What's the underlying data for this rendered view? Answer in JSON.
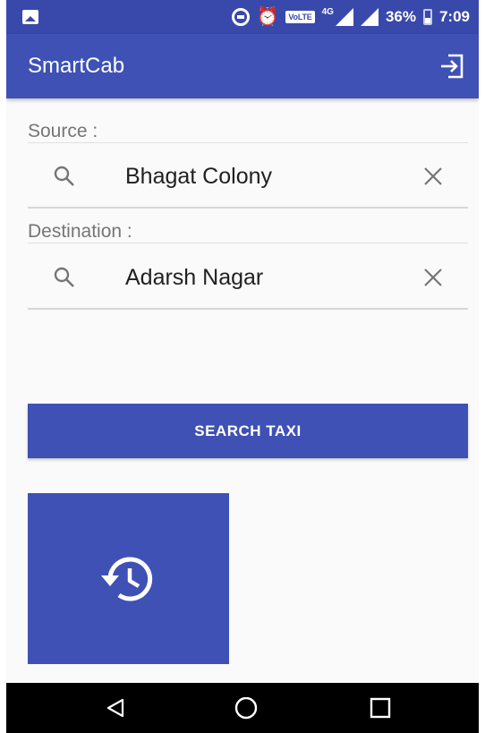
{
  "status_bar": {
    "network_label": "4G",
    "volte_label": "VoLTE",
    "battery": "36%",
    "time": "7:09",
    "icons": [
      "gallery-icon",
      "data-saver-icon",
      "alarm-icon",
      "signal-icon",
      "battery-icon"
    ]
  },
  "app_bar": {
    "title": "SmartCab",
    "action_icon": "logout-icon"
  },
  "form": {
    "source": {
      "label": "Source :",
      "value": "Bhagat Colony"
    },
    "destination": {
      "label": "Destination :",
      "value": "Adarsh Nagar"
    }
  },
  "search_button": {
    "label": "SEARCH TAXI"
  },
  "history_tile": {
    "icon": "history-icon"
  },
  "nav_bar": {
    "icons": [
      "back-icon",
      "home-icon",
      "recents-icon"
    ]
  },
  "colors": {
    "primary": "#3f51b5",
    "primary_dark": "#3949ab",
    "background": "#fafafa"
  }
}
